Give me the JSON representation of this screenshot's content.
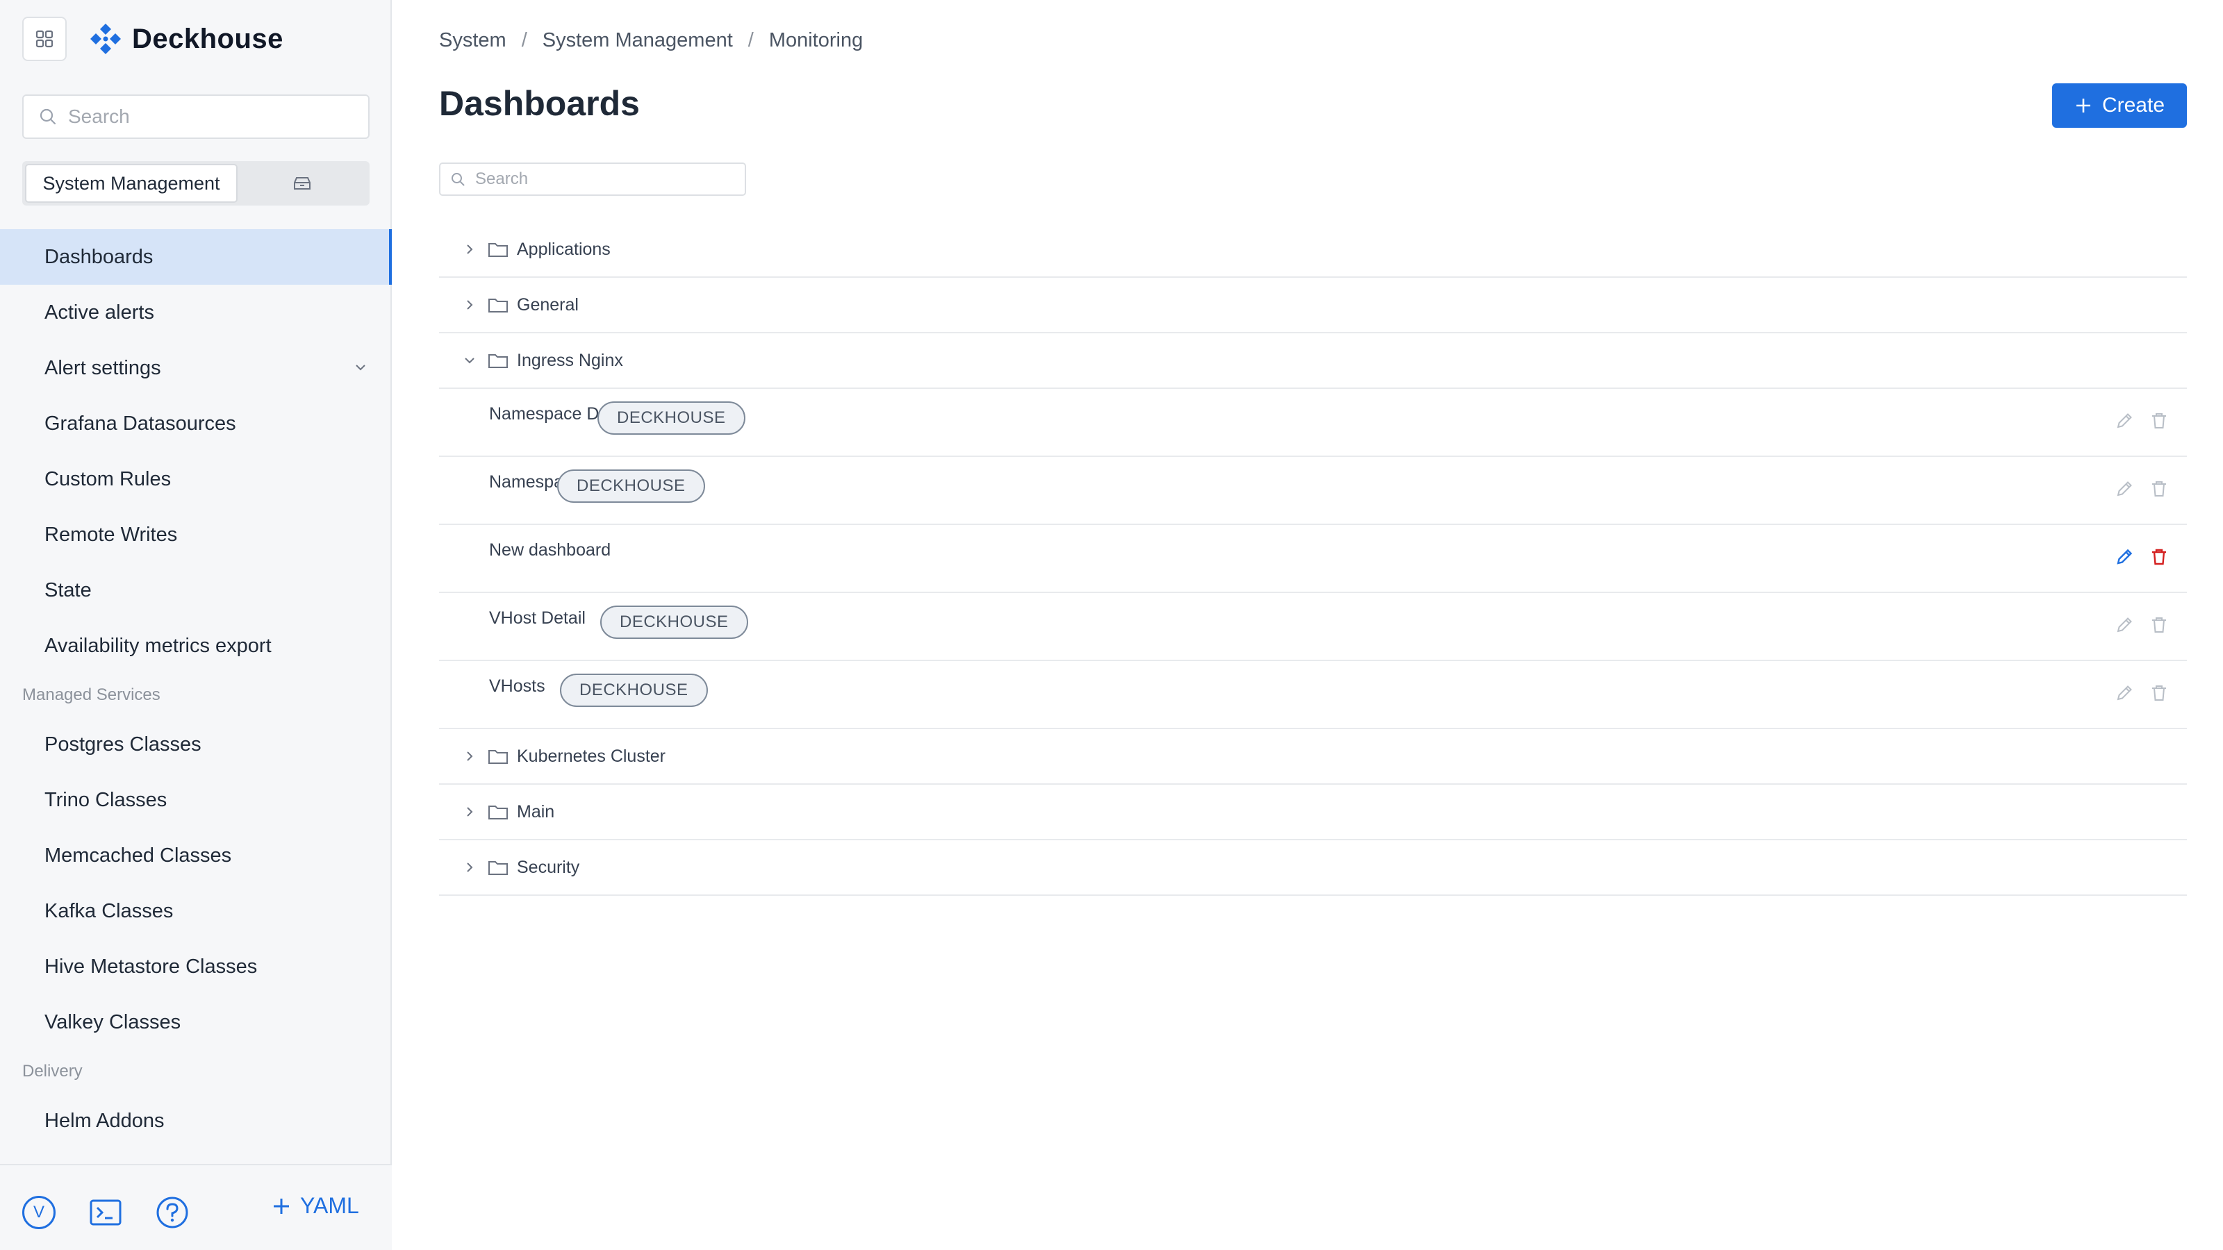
{
  "app": {
    "brand": "Deckhouse"
  },
  "colors": {
    "accent": "#1f6fe0",
    "danger": "#d42020",
    "muted_icon": "#b8bec6"
  },
  "sidebar": {
    "search_placeholder": "Search",
    "segment": {
      "selected": "System Management",
      "other_icon": "archive-icon"
    },
    "items": [
      {
        "label": "Dashboards",
        "active": true
      },
      {
        "label": "Active alerts"
      },
      {
        "label": "Alert settings",
        "expandable": true
      },
      {
        "label": "Grafana Datasources"
      },
      {
        "label": "Custom Rules"
      },
      {
        "label": "Remote Writes"
      },
      {
        "label": "State"
      },
      {
        "label": "Availability metrics export"
      }
    ],
    "groups": [
      {
        "title": "Managed Services",
        "items": [
          {
            "label": "Postgres Classes"
          },
          {
            "label": "Trino Classes"
          },
          {
            "label": "Memcached Classes"
          },
          {
            "label": "Kafka Classes"
          },
          {
            "label": "Hive Metastore Classes"
          },
          {
            "label": "Valkey Classes"
          }
        ]
      },
      {
        "title": "Delivery",
        "items": [
          {
            "label": "Helm Addons"
          }
        ]
      }
    ],
    "bottom": {
      "avatar_letter": "V",
      "yaml_label": "YAML"
    }
  },
  "main": {
    "breadcrumb": [
      "System",
      "System Management",
      "Monitoring"
    ],
    "title": "Dashboards",
    "create_label": "Create",
    "search_placeholder": "Search",
    "folders_before": [
      "Applications",
      "General"
    ],
    "open_folder": {
      "name": "Ingress Nginx",
      "dashboards": [
        {
          "name": "Namespace Detail",
          "badge": "DECKHOUSE",
          "editable": false
        },
        {
          "name": "Namespaces",
          "badge": "DECKHOUSE",
          "editable": false
        },
        {
          "name": "New dashboard",
          "badge": "",
          "editable": true
        },
        {
          "name": "VHost Detail",
          "badge": "DECKHOUSE",
          "editable": false
        },
        {
          "name": "VHosts",
          "badge": "DECKHOUSE",
          "editable": false
        }
      ]
    },
    "folders_after": [
      "Kubernetes Cluster",
      "Main",
      "Security"
    ]
  }
}
